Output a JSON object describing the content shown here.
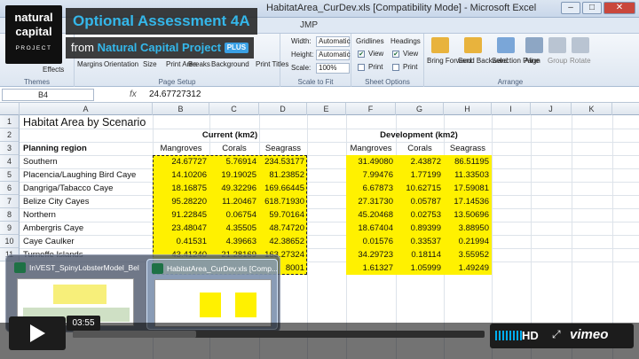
{
  "window": {
    "title": "HabitatArea_CurDev.xls  [Compatibility Mode] - Microsoft Excel",
    "tab_extra": "JMP",
    "minimize": "–",
    "maximize": "□",
    "close": "✕"
  },
  "video": {
    "title": "Optional Assessment 4A",
    "byline_from": "from",
    "byline_name": "Natural Capital Project",
    "byline_badge": "PLUS",
    "logo_line1": "natural",
    "logo_line2": "capital",
    "logo_line3": "PROJECT",
    "time": "03:55",
    "progress_fraction": 0.0,
    "hd_label": "HD",
    "brand": "vimeo"
  },
  "ribbon": {
    "themes_group": "Themes",
    "effects_label": "Effects",
    "page_setup": {
      "items": [
        "Margins",
        "Orientation",
        "Size",
        "Print\nArea",
        "Breaks",
        "Background",
        "Print\nTitles"
      ],
      "label": "Page Setup"
    },
    "scale_to_fit": {
      "width_label": "Width:",
      "width_value": "Automatic",
      "height_label": "Height:",
      "height_value": "Automatic",
      "scale_label": "Scale:",
      "scale_value": "100%",
      "label": "Scale to Fit"
    },
    "sheet_options": {
      "gridlines": "Gridlines",
      "headings": "Headings",
      "view": "View",
      "print": "Print",
      "label": "Sheet Options"
    },
    "arrange": {
      "items": [
        "Bring\nForward",
        "Send\nBackward",
        "Selection\nPane",
        "Align",
        "Group",
        "Rotate"
      ],
      "label": "Arrange"
    }
  },
  "formula_bar": {
    "name_box": "B4",
    "fx": "fx",
    "value": "24.67727312"
  },
  "columns": [
    "A",
    "B",
    "C",
    "D",
    "E",
    "F",
    "G",
    "H",
    "I",
    "J",
    "K"
  ],
  "rows": [
    "1",
    "2",
    "3",
    "4",
    "5",
    "6",
    "7",
    "8",
    "9",
    "10",
    "11"
  ],
  "sheet": {
    "title": "Habitat Area by Scenario",
    "current_header": "Current (km2)",
    "development_header": "Development (km2)",
    "region_header": "Planning region",
    "col_headers": [
      "Mangroves",
      "Corals",
      "Seagrass"
    ],
    "regions": [
      "Southern",
      "Placencia/Laughing Bird Caye",
      "Dangriga/Tabacco Caye",
      "Belize City Cayes",
      "Northern",
      "Ambergris Caye",
      "Caye Caulker",
      "Turneffe Islands"
    ],
    "current": [
      [
        "24.67727",
        "5.76914",
        "234.53177"
      ],
      [
        "14.10206",
        "19.19025",
        "81.23852"
      ],
      [
        "18.16875",
        "49.32296",
        "169.66445"
      ],
      [
        "95.28220",
        "11.20467",
        "618.71930"
      ],
      [
        "91.22845",
        "0.06754",
        "59.70164"
      ],
      [
        "23.48047",
        "4.35505",
        "48.74720"
      ],
      [
        "0.41531",
        "4.39663",
        "42.38652"
      ],
      [
        "43.41240",
        "21.28169",
        "163.27324"
      ],
      [
        "",
        "",
        "8001"
      ]
    ],
    "development": [
      [
        "31.49080",
        "2.43872",
        "86.51195"
      ],
      [
        "7.99476",
        "1.77199",
        "11.33503"
      ],
      [
        "6.67873",
        "10.62715",
        "17.59081"
      ],
      [
        "27.31730",
        "0.05787",
        "17.14536"
      ],
      [
        "45.20468",
        "0.02753",
        "13.50696"
      ],
      [
        "18.67404",
        "0.89399",
        "3.88950"
      ],
      [
        "0.01576",
        "0.33537",
        "0.21994"
      ],
      [
        "34.29723",
        "0.18114",
        "3.55952"
      ],
      [
        "1.61327",
        "1.05999",
        "1.49249"
      ]
    ]
  },
  "taskbar": {
    "thumb1_title": "InVEST_SpinyLobsterModel_Beli...",
    "thumb2_title": "HabitatArea_CurDev.xls  [Comp..."
  }
}
